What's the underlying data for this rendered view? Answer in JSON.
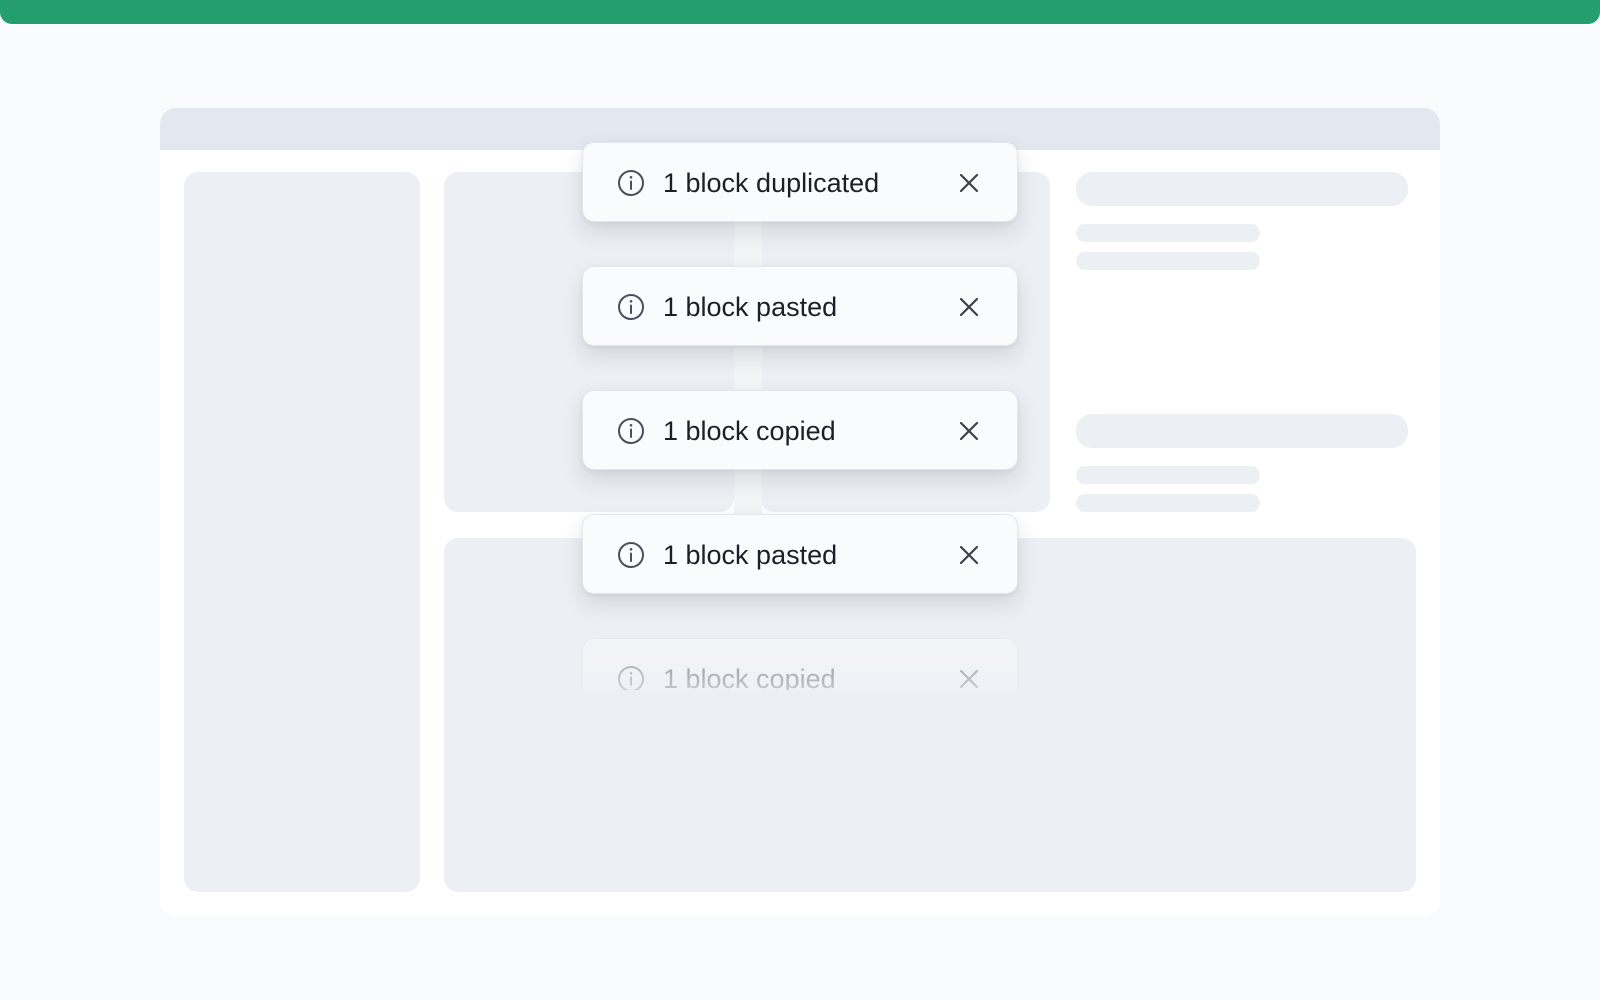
{
  "accent_color": "#249e6c",
  "toasts": [
    {
      "icon": "info-icon",
      "message": "1 block duplicated",
      "close_icon": "close-icon"
    },
    {
      "icon": "info-icon",
      "message": "1 block pasted",
      "close_icon": "close-icon"
    },
    {
      "icon": "info-icon",
      "message": "1 block copied",
      "close_icon": "close-icon"
    },
    {
      "icon": "info-icon",
      "message": "1 block pasted",
      "close_icon": "close-icon"
    },
    {
      "icon": "info-icon",
      "message": "1 block copied",
      "close_icon": "close-icon"
    }
  ]
}
